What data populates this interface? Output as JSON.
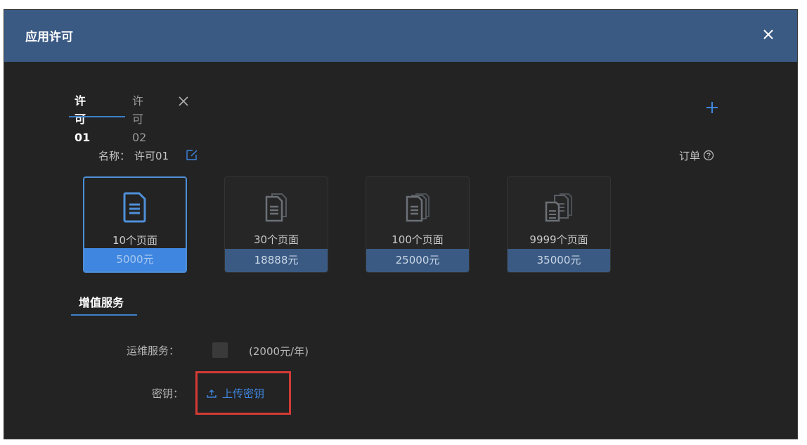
{
  "dialog": {
    "title": "应用许可",
    "close_icon": "close-icon"
  },
  "tabs": [
    {
      "label": "许可01",
      "active": true
    },
    {
      "label": "许可02",
      "active": false
    }
  ],
  "tab_close_icon": "close-icon",
  "add_icon": "plus-icon",
  "name": {
    "label": "名称：",
    "value": "许可01",
    "edit_icon": "edit-icon"
  },
  "order": {
    "label": "订单",
    "icon": "help-circle-icon"
  },
  "plans": [
    {
      "pages": "10个页面",
      "price": "5000元",
      "icon": "document-icon",
      "selected": true
    },
    {
      "pages": "30个页面",
      "price": "18888元",
      "icon": "documents-icon",
      "selected": false
    },
    {
      "pages": "100个页面",
      "price": "25000元",
      "icon": "documents-stack-icon",
      "selected": false
    },
    {
      "pages": "9999个页面",
      "price": "35000元",
      "icon": "documents-multi-icon",
      "selected": false
    }
  ],
  "value_added": {
    "title": "增值服务",
    "ops_label": "运维服务：",
    "ops_price": "(2000元/年)",
    "key_label": "密钥：",
    "upload_label": "上传密钥",
    "upload_icon": "upload-icon"
  },
  "colors": {
    "header_bg": "#3a5a83",
    "dialog_bg": "#232323",
    "accent": "#3f86e0",
    "highlight_border": "#d33a36"
  }
}
